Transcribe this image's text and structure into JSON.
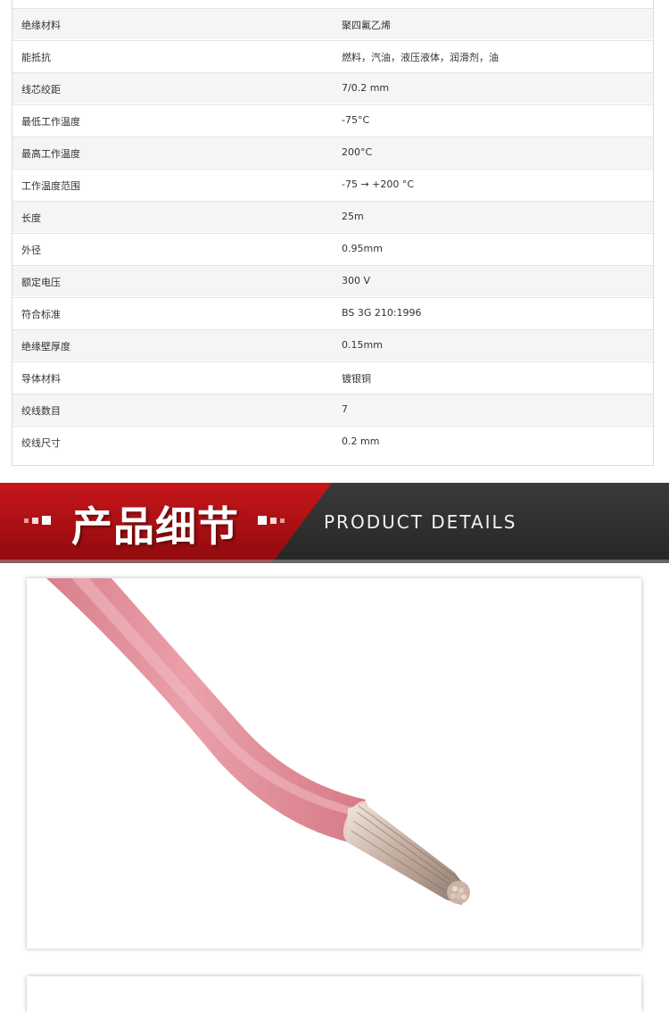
{
  "specs": [
    {
      "label": "绝缘材料",
      "value": "聚四氟乙烯"
    },
    {
      "label": "能抵抗",
      "value": "燃料，汽油，液压液体，润滑剂，油"
    },
    {
      "label": "线芯绞距",
      "value": "7/0.2 mm"
    },
    {
      "label": "最低工作温度",
      "value": "-75°C"
    },
    {
      "label": "最高工作温度",
      "value": "200°C"
    },
    {
      "label": "工作温度范围",
      "value": "-75 → +200 °C"
    },
    {
      "label": "长度",
      "value": "25m"
    },
    {
      "label": "外径",
      "value": "0.95mm"
    },
    {
      "label": "额定电压",
      "value": "300 V"
    },
    {
      "label": "符合标准",
      "value": "BS 3G 210:1996"
    },
    {
      "label": "绝缘壁厚度",
      "value": "0.15mm"
    },
    {
      "label": "导体材料",
      "value": "镀银铜"
    },
    {
      "label": "绞线数目",
      "value": "7"
    },
    {
      "label": "绞线尺寸",
      "value": "0.2 mm"
    }
  ],
  "banner": {
    "title_cn": "产品细节",
    "title_en": "PRODUCT  DETAILS",
    "colors": {
      "red": "#b50d12",
      "dark": "#2f2f2f"
    }
  },
  "photo": {
    "subject": "pink-insulated-wire-with-stranded-silver-core",
    "insulation_color": "#e3909a"
  }
}
